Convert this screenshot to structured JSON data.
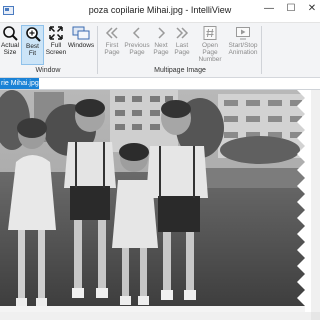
{
  "window": {
    "title": "poza copilarie Mihai.jpg - IntelliView",
    "buttons": {
      "minimize": "—",
      "maximize": "☐",
      "close": "✕"
    }
  },
  "ribbon": {
    "window_group": {
      "label": "Window",
      "buttons": [
        {
          "label": "Actual Size",
          "icon": "search-icon"
        },
        {
          "label": "Best Fit",
          "icon": "zoom-fit-icon",
          "active": true
        },
        {
          "label": "Full Screen",
          "icon": "fullscreen-icon"
        },
        {
          "label": "Windows",
          "icon": "windows-icon"
        }
      ]
    },
    "multipage_group": {
      "label": "Multipage Image",
      "buttons": [
        {
          "label": "First Page",
          "icon": "first-page-icon"
        },
        {
          "label": "Previous Page",
          "icon": "previous-page-icon"
        },
        {
          "label": "Next Page",
          "icon": "next-page-icon"
        },
        {
          "label": "Last Page",
          "icon": "last-page-icon"
        },
        {
          "label": "Open Page Number",
          "icon": "hash-icon"
        },
        {
          "label": "Start/Stop Animation",
          "icon": "animation-icon"
        }
      ]
    }
  },
  "tabs": [
    {
      "label": "rie Mihai.jpg"
    }
  ],
  "image": {
    "description_icon": "photo-icon"
  },
  "colors": {
    "accent": "#1a82d6",
    "ribbon_bg": "#f3f4f6"
  }
}
